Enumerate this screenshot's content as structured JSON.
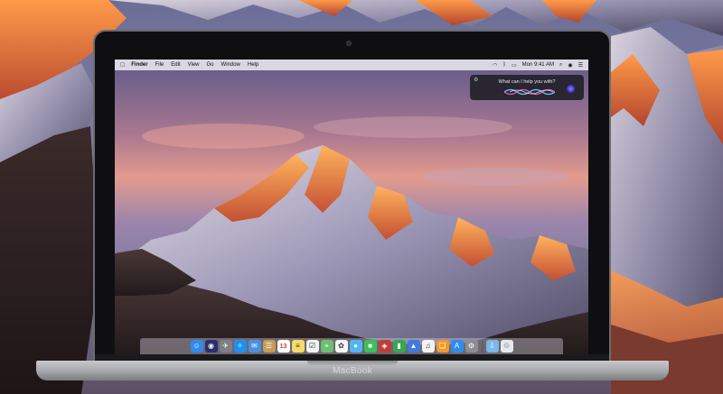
{
  "device": {
    "brand_label": "MacBook"
  },
  "menubar": {
    "apple_icon": "apple-icon",
    "items": [
      "Finder",
      "File",
      "Edit",
      "View",
      "Go",
      "Window",
      "Help"
    ],
    "status_icons": [
      "wifi-icon",
      "bluetooth-icon",
      "battery-icon",
      "search-icon",
      "siri-icon",
      "list-icon"
    ],
    "clock": "Mon 9:41 AM"
  },
  "siri": {
    "prompt": "What can I help you with?",
    "gear_icon": "gear-icon"
  },
  "dock": {
    "apps": [
      {
        "name": "finder",
        "glyph": "☺",
        "color": "#2f8bf0"
      },
      {
        "name": "siri",
        "glyph": "◉",
        "color": "#2b2d6e"
      },
      {
        "name": "launchpad",
        "glyph": "✈",
        "color": "#7c7f86"
      },
      {
        "name": "safari",
        "glyph": "✧",
        "color": "#1f8ff0"
      },
      {
        "name": "mail",
        "glyph": "✉",
        "color": "#4a90e2"
      },
      {
        "name": "contacts",
        "glyph": "☰",
        "color": "#c69d57"
      },
      {
        "name": "calendar",
        "glyph": "13",
        "color": "#ffffff"
      },
      {
        "name": "notes",
        "glyph": "≡",
        "color": "#f4dd6a"
      },
      {
        "name": "reminders",
        "glyph": "☑",
        "color": "#f2f2f2"
      },
      {
        "name": "maps",
        "glyph": "⌖",
        "color": "#6cc070"
      },
      {
        "name": "photos",
        "glyph": "✿",
        "color": "#f5f5f5"
      },
      {
        "name": "messages",
        "glyph": "●",
        "color": "#4fb6f5"
      },
      {
        "name": "facetime",
        "glyph": "■",
        "color": "#3ac15a"
      },
      {
        "name": "photo-booth",
        "glyph": "◈",
        "color": "#c23b3b"
      },
      {
        "name": "numbers",
        "glyph": "▮",
        "color": "#36a852"
      },
      {
        "name": "keynote",
        "glyph": "▲",
        "color": "#3f7ae0"
      },
      {
        "name": "itunes",
        "glyph": "♫",
        "color": "#f2f2f2"
      },
      {
        "name": "ibooks",
        "glyph": "❑",
        "color": "#f29a2e"
      },
      {
        "name": "app-store",
        "glyph": "A",
        "color": "#2f8bf0"
      },
      {
        "name": "system-preferences",
        "glyph": "⚙",
        "color": "#8a8d93"
      },
      {
        "name": "downloads-folder",
        "glyph": "⇩",
        "color": "#7ab7ea"
      },
      {
        "name": "trash",
        "glyph": "♲",
        "color": "#e6e9ee"
      }
    ]
  }
}
